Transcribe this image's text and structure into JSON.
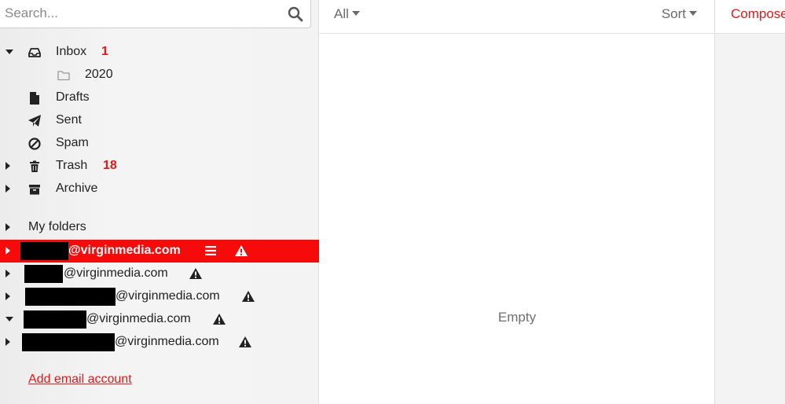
{
  "search": {
    "placeholder": "Search..."
  },
  "folders": [
    {
      "label": "Inbox",
      "count": "1",
      "icon": "inbox-icon"
    },
    {
      "label": "2020",
      "icon": "folder-icon"
    },
    {
      "label": "Drafts",
      "icon": "file-icon"
    },
    {
      "label": "Sent",
      "icon": "paper-plane-icon"
    },
    {
      "label": "Spam",
      "icon": "ban-icon"
    },
    {
      "label": "Trash",
      "count": "18",
      "icon": "trash-icon"
    },
    {
      "label": "Archive",
      "icon": "archive-icon"
    }
  ],
  "my_folders_label": "My folders",
  "accounts": [
    {
      "domain": "@virginmedia.com",
      "active": true
    },
    {
      "domain": "@virginmedia.com"
    },
    {
      "domain": "@virginmedia.com"
    },
    {
      "domain": "@virginmedia.com"
    },
    {
      "domain": "@virginmedia.com"
    }
  ],
  "add_account_label": "Add email account",
  "list": {
    "filter_label": "All",
    "sort_label": "Sort",
    "empty_label": "Empty"
  },
  "compose_label": "Compose",
  "colors": {
    "accent": "#f70a0a",
    "link": "#e01b1b",
    "badge": "#d81b1b"
  }
}
